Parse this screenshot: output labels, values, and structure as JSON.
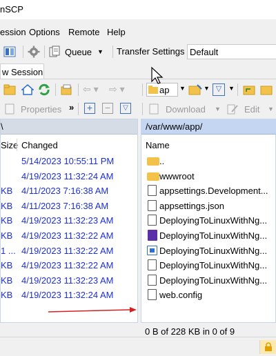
{
  "window": {
    "title": "nSCP"
  },
  "menu": [
    "ession",
    "Options",
    "Remote",
    "Help"
  ],
  "toolbar": {
    "queue_label": "Queue",
    "transfer_settings_label": "Transfer Settings",
    "transfer_settings_value": "Default",
    "properties_label": "Properties",
    "download_label": "Download",
    "edit_label": "Edit",
    "path_dropdown": "ap"
  },
  "tabs": [
    {
      "label": "w Session"
    }
  ],
  "left_panel": {
    "path": "\\",
    "headers": {
      "size": "Size",
      "changed": "Changed"
    },
    "rows": [
      {
        "size": "",
        "changed": "5/14/2023  10:55:11 PM"
      },
      {
        "size": "",
        "changed": "4/19/2023  11:32:24 AM"
      },
      {
        "size": "KB",
        "changed": "4/11/2023  7:16:38 AM"
      },
      {
        "size": "KB",
        "changed": "4/11/2023  7:16:38 AM"
      },
      {
        "size": "KB",
        "changed": "4/19/2023  11:32:23 AM"
      },
      {
        "size": "KB",
        "changed": "4/19/2023  11:32:22 AM"
      },
      {
        "size": "1 ...",
        "changed": "4/19/2023  11:32:22 AM"
      },
      {
        "size": "KB",
        "changed": "4/19/2023  11:32:22 AM"
      },
      {
        "size": "KB",
        "changed": "4/19/2023  11:32:23 AM"
      },
      {
        "size": "KB",
        "changed": "4/19/2023  11:32:24 AM"
      }
    ]
  },
  "right_panel": {
    "path": "/var/www/app/",
    "headers": {
      "name": "Name"
    },
    "rows": [
      {
        "name": "..",
        "icon": "parent-folder-icon"
      },
      {
        "name": "wwwroot",
        "icon": "folder-icon"
      },
      {
        "name": "appsettings.Development...",
        "icon": "file-icon"
      },
      {
        "name": "appsettings.json",
        "icon": "file-icon"
      },
      {
        "name": "DeployingToLinuxWithNg...",
        "icon": "file-icon"
      },
      {
        "name": "DeployingToLinuxWithNg...",
        "icon": "project-file-icon"
      },
      {
        "name": "DeployingToLinuxWithNg...",
        "icon": "executable-icon"
      },
      {
        "name": "DeployingToLinuxWithNg...",
        "icon": "file-icon"
      },
      {
        "name": "DeployingToLinuxWithNg...",
        "icon": "file-icon"
      },
      {
        "name": "web.config",
        "icon": "file-icon"
      }
    ],
    "status": "0 B of 228 KB in 0 of 9"
  },
  "colors": {
    "link_blue": "#1c2fd6",
    "path_bar": "#c4d6f2",
    "arrow_red": "#d62020"
  }
}
